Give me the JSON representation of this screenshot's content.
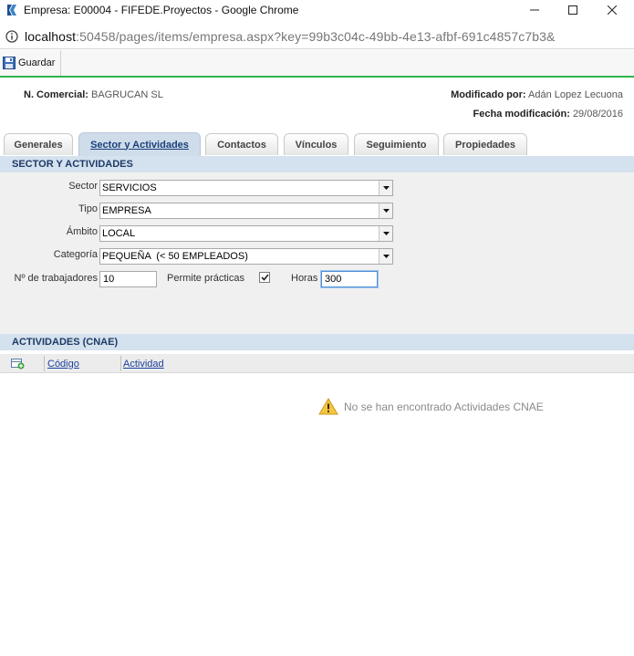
{
  "window": {
    "title": "Empresa: E00004 - FIFEDE.Proyectos - Google Chrome",
    "url_host": "localhost",
    "url_rest": ":50458/pages/items/empresa.aspx?key=99b3c04c-49bb-4e13-afbf-691c4857c7b3&"
  },
  "toolbar": {
    "save_label": "Guardar"
  },
  "header": {
    "comercial_label": "N. Comercial:",
    "comercial_value": "BAGRUCAN SL",
    "modificado_label": "Modificado por:",
    "modificado_value": "Adán Lopez Lecuona",
    "fecha_label": "Fecha modificación:",
    "fecha_value": "29/08/2016"
  },
  "tabs": [
    {
      "label": "Generales",
      "active": false
    },
    {
      "label": "Sector y Actividades",
      "active": true
    },
    {
      "label": "Contactos",
      "active": false
    },
    {
      "label": "Vínculos",
      "active": false
    },
    {
      "label": "Seguimiento",
      "active": false
    },
    {
      "label": "Propiedades",
      "active": false
    }
  ],
  "sector_section": {
    "title": "SECTOR Y ACTIVIDADES",
    "sector_label": "Sector",
    "sector_value": "SERVICIOS",
    "tipo_label": "Tipo",
    "tipo_value": "EMPRESA",
    "ambito_label": "Ámbito",
    "ambito_value": "LOCAL",
    "categoria_label": "Categoría",
    "categoria_value": "PEQUEÑA  (< 50 EMPLEADOS)",
    "trabajadores_label": "Nº de trabajadores",
    "trabajadores_value": "10",
    "practicas_label": "Permite prácticas",
    "practicas_checked": true,
    "horas_label": "Horas",
    "horas_value": "300"
  },
  "activities_section": {
    "title": "ACTIVIDADES (CNAE)",
    "col_codigo": "Código",
    "col_actividad": "Actividad",
    "empty_message": "No se han encontrado Actividades CNAE"
  },
  "colors": {
    "accent_green": "#2fb44a",
    "section_bar": "#d4e1ee",
    "active_tab": "#cfdcea"
  }
}
